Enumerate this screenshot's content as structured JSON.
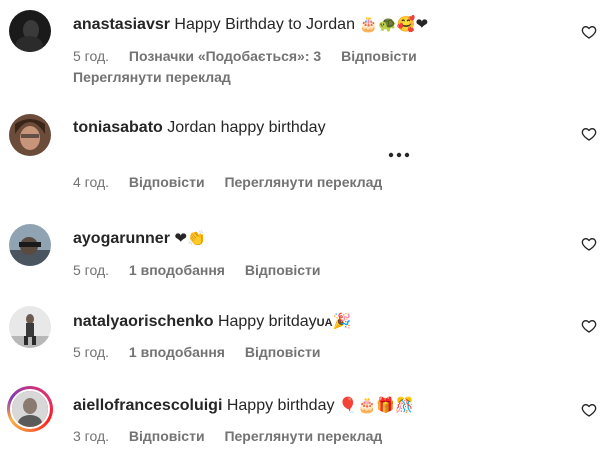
{
  "comments": [
    {
      "username": "anastasiavsr",
      "text": "Happy Birthday to Jordan",
      "emojis": "🎂🐢🥰❤",
      "time": "5 год.",
      "likes": "Позначки «Подобається»: 3",
      "reply": "Відповісти",
      "translate": "Переглянути переклад"
    },
    {
      "username": "toniasabato",
      "text": "Jordan happy birthday",
      "time": "4 год.",
      "reply": "Відповісти",
      "translate": "Переглянути переклад"
    },
    {
      "username": "ayogarunner",
      "emojis": "❤👏",
      "time": "5 год.",
      "likes": "1 вподобання",
      "reply": "Відповісти"
    },
    {
      "username": "natalyaorischenko",
      "text": "Happy britday",
      "flag": "UA",
      "emojis": "🎉",
      "time": "5 год.",
      "likes": "1 вподобання",
      "reply": "Відповісти"
    },
    {
      "username": "aiellofrancescoluigi",
      "text": "Happy birthday",
      "emojis": "🎈🎂🎁🎊",
      "time": "3 год.",
      "reply": "Відповісти",
      "translate": "Переглянути переклад"
    }
  ],
  "icons": {
    "like": "heart-outline-icon",
    "more": "more-horizontal-icon"
  },
  "colors": {
    "text": "#262626",
    "meta": "#737373",
    "story_ring": "#e1306c"
  }
}
